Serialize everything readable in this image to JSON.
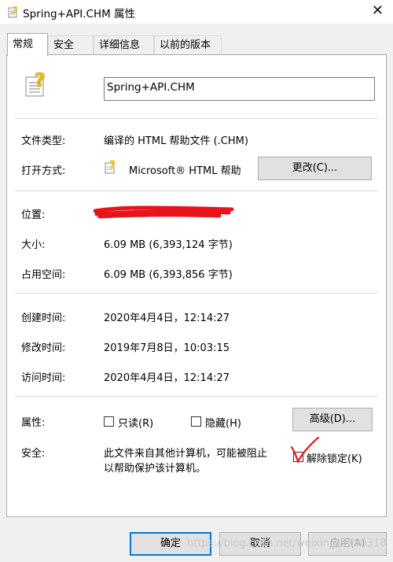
{
  "window": {
    "title": "Spring+API.CHM 属性"
  },
  "tabs": [
    {
      "label": "常规",
      "active": true
    },
    {
      "label": "安全"
    },
    {
      "label": "详细信息"
    },
    {
      "label": "以前的版本"
    }
  ],
  "general": {
    "file_name": "Spring+API.CHM",
    "type_label": "文件类型:",
    "type_value": "编译的 HTML 帮助文件 (.CHM)",
    "open_with_label": "打开方式:",
    "open_with_value": "Microsoft® HTML 帮助",
    "change_button": "更改(C)...",
    "location_label": "位置:",
    "size_label": "大小:",
    "size_value": "6.09 MB (6,393,124 字节)",
    "disk_size_label": "占用空间:",
    "disk_size_value": "6.09 MB (6,393,856 字节)",
    "created_label": "创建时间:",
    "created_value": "2020年4月4日，12:14:27",
    "modified_label": "修改时间:",
    "modified_value": "2019年7月8日，10:03:15",
    "accessed_label": "访问时间:",
    "accessed_value": "2020年4月4日，12:14:27",
    "attributes_label": "属性:",
    "readonly_label": "只读(R)",
    "hidden_label": "隐藏(H)",
    "advanced_button": "高级(D)...",
    "security_label": "安全:",
    "security_text_line1": "此文件来自其他计算机，可能被阻止",
    "security_text_line2": "以帮助保护该计算机。",
    "unblock_label": "解除锁定(K)"
  },
  "footer": {
    "ok": "确定",
    "cancel": "取消",
    "apply": "应用(A)"
  },
  "watermark": "https://blog.csdn.net/weixin_45680318",
  "colors": {
    "focus_border": "#0078d7",
    "annotation": "#e8141b"
  }
}
